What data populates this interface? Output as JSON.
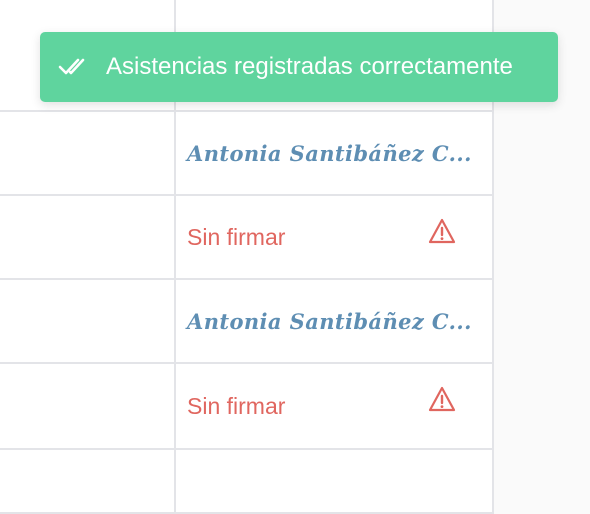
{
  "toast": {
    "message": "Asistencias registradas correctamente",
    "icon": "double-check-icon",
    "color": "#5fd49e"
  },
  "rows": [
    {
      "status": "signed",
      "signature": "Antonia Santibáñez C..."
    },
    {
      "status": "unsigned",
      "label": "Sin firmar",
      "icon": "warning-icon"
    },
    {
      "status": "signed",
      "signature": "Antonia Santibáñez C..."
    },
    {
      "status": "unsigned",
      "label": "Sin firmar",
      "icon": "warning-icon"
    }
  ],
  "colors": {
    "signature": "#5e8eb3",
    "unsigned": "#e0665f",
    "grid": "#e3e4e8"
  }
}
